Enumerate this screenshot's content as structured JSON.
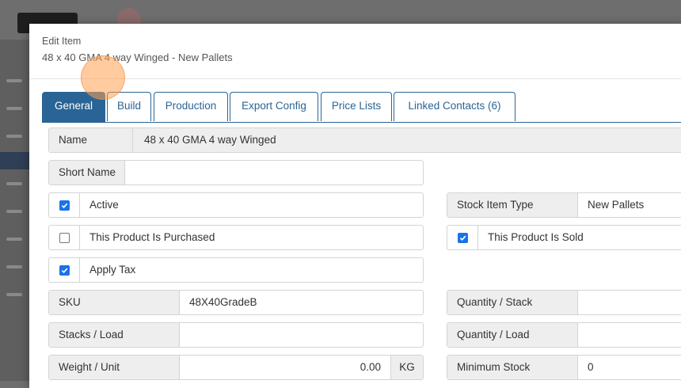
{
  "modal": {
    "label": "Edit Item",
    "subtitle": "48 x 40 GMA 4 way Winged - New Pallets"
  },
  "tabs": [
    {
      "label": "General",
      "active": true
    },
    {
      "label": "Build"
    },
    {
      "label": "Production"
    },
    {
      "label": "Export Config"
    },
    {
      "label": "Price Lists"
    },
    {
      "label": "Linked Contacts (6)"
    }
  ],
  "form": {
    "name": {
      "label": "Name",
      "value": "48 x 40 GMA 4 way Winged"
    },
    "short_name": {
      "label": "Short Name",
      "value": ""
    },
    "active": {
      "label": "Active",
      "checked": true
    },
    "purchased": {
      "label": "This Product Is Purchased",
      "checked": false
    },
    "apply_tax": {
      "label": "Apply Tax",
      "checked": true
    },
    "sku": {
      "label": "SKU",
      "value": "48X40GradeB"
    },
    "stacks_load": {
      "label": "Stacks / Load",
      "value": ""
    },
    "weight_unit": {
      "label": "Weight / Unit",
      "value": "0.00",
      "unit": "KG"
    },
    "stock_item_type": {
      "label": "Stock Item Type",
      "value": "New Pallets"
    },
    "sold": {
      "label": "This Product Is Sold",
      "checked": true
    },
    "quantity_stack": {
      "label": "Quantity / Stack",
      "value": ""
    },
    "quantity_load": {
      "label": "Quantity / Load",
      "value": ""
    },
    "minimum_stock": {
      "label": "Minimum Stock",
      "value": "0"
    }
  },
  "colors": {
    "accent": "#2a6496",
    "checkbox": "#1a73e8",
    "label_bg": "#eeeeee"
  }
}
